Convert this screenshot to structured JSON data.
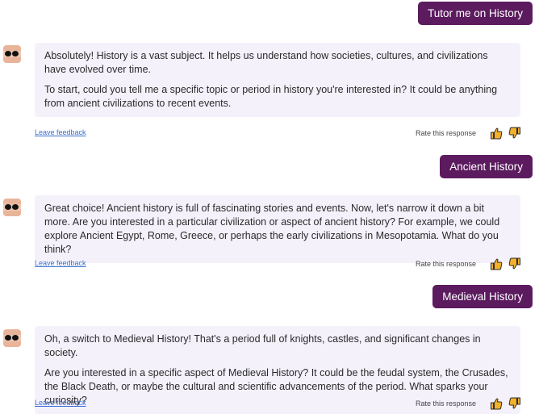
{
  "conversation": {
    "turns": [
      {
        "user_message": "Tutor me on History",
        "assistant_paragraphs": [
          "Absolutely! History is a vast subject. It helps us understand how societies, cultures, and civilizations have evolved over time.",
          "To start, could you tell me a specific topic or period in history you're interested in? It could be anything from ancient civilizations to recent events."
        ]
      },
      {
        "user_message": "Ancient History",
        "assistant_paragraphs": [
          "Great choice! Ancient history is full of fascinating stories and events. Now, let's narrow it down a bit more. Are you interested in a particular civilization or aspect of ancient history? For example, we could explore Ancient Egypt, Rome, Greece, or perhaps the early civilizations in Mesopotamia. What do you think?"
        ]
      },
      {
        "user_message": "Medieval History",
        "assistant_paragraphs": [
          "Oh, a switch to Medieval History! That's a period full of knights, castles, and significant changes in society.",
          "Are you interested in a specific aspect of Medieval History? It could be the feudal system, the Crusades, the Black Death, or maybe the cultural and scientific advancements of the period. What sparks your curiosity?"
        ]
      }
    ]
  },
  "feedback": {
    "leave_feedback_label": "Leave feedback",
    "rate_label": "Rate this response",
    "thumbs_up_icon": "thumbs-up-icon",
    "thumbs_down_icon": "thumbs-down-icon"
  },
  "colors": {
    "user_bubble": "#5c1b5f",
    "assistant_bubble": "#f4f1fb",
    "link": "#3a6fd0",
    "thumb_fill": "#f2b02b"
  }
}
